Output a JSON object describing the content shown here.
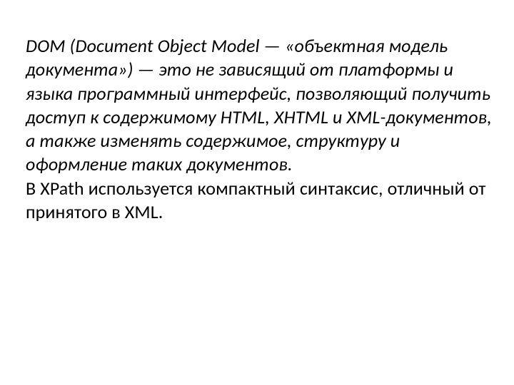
{
  "document": {
    "paragraph_italic": "DOM (Document Object Model — «объектная модель документа») — это не зависящий от платформы и языка программный интерфейс, позволяющий получить доступ к содержимому HTML, XHTML и XML-документов, а также изменять содержимое, структуру и оформление таких документов.",
    "paragraph_plain": " В XPath используется компактный синтаксис, отличный от принятого в XML."
  }
}
